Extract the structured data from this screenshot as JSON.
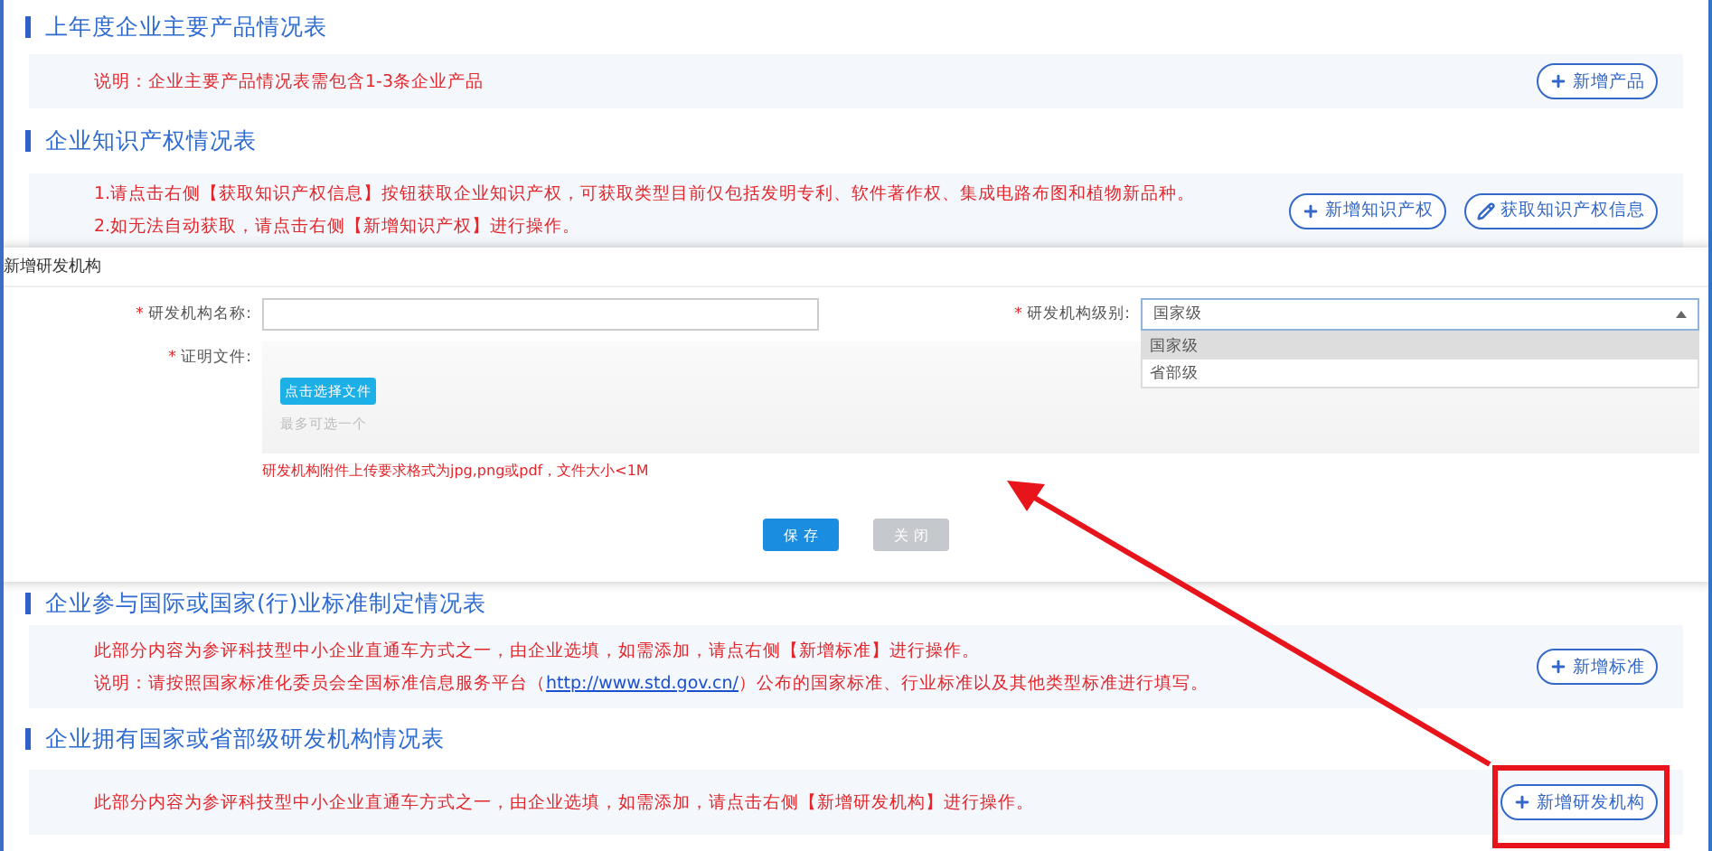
{
  "upper_sections": [
    {
      "title": "上年度企业主要产品情况表",
      "notes": [
        {
          "parts": [
            {
              "kind": "text",
              "text": "说明：企业主要产品情况表需包含1-3条企业产品"
            }
          ]
        }
      ],
      "buttons": [
        {
          "label": "新增产品",
          "kind": "add"
        }
      ]
    },
    {
      "title": "企业知识产权情况表",
      "notes": [
        {
          "parts": [
            {
              "kind": "text",
              "text": "1.请点击右侧【获取知识产权信息】按钮获取企业知识产权，可获取类型目前仅包括发明专利、软件著作权、集成电路布图和植物新品种。"
            }
          ]
        },
        {
          "parts": [
            {
              "kind": "text",
              "text": "2.如无法自动获取，请点击右侧【新增知识产权】进行操作。"
            }
          ]
        }
      ],
      "buttons": [
        {
          "label": "新增知识产权",
          "kind": "add"
        },
        {
          "label": "获取知识产权信息",
          "kind": "fetch"
        }
      ]
    }
  ],
  "dialog": {
    "title": "新增研发机构",
    "name_field": {
      "label": "研发机构名称:",
      "marker": "*"
    },
    "level_field": {
      "label": "研发机构级别:",
      "marker": "*",
      "value": "国家级",
      "expanded": true,
      "options": [
        {
          "label": "国家级",
          "selected": true
        },
        {
          "label": "省部级",
          "selected": false
        }
      ]
    },
    "file_field": {
      "label": "证明文件:",
      "marker": "*",
      "button": "点击选择文件",
      "hint": "最多可选一个",
      "note": "研发机构附件上传要求格式为jpg,png或pdf，文件大小<1M"
    },
    "buttons": [
      {
        "label": "保 存",
        "kind": "primary"
      },
      {
        "label": "关 闭",
        "kind": "secondary"
      }
    ]
  },
  "lower_sections": [
    {
      "title": "企业参与国际或国家(行)业标准制定情况表",
      "notes": [
        {
          "parts": [
            {
              "kind": "text",
              "text": "此部分内容为参评科技型中小企业直通车方式之一，由企业选填，如需添加，请点右侧【新增标准】进行操作。"
            }
          ]
        },
        {
          "parts": [
            {
              "kind": "text",
              "text": "说明：请按照国家标准化委员会全国标准信息服务平台（"
            },
            {
              "kind": "link",
              "text": "http://www.std.gov.cn/"
            },
            {
              "kind": "text",
              "text": "）公布的国家标准、行业标准以及其他类型标准进行填写。"
            }
          ]
        }
      ],
      "buttons": [
        {
          "label": "新增标准",
          "kind": "add"
        }
      ]
    },
    {
      "title": "企业拥有国家或省部级研发机构情况表",
      "notes": [
        {
          "parts": [
            {
              "kind": "text",
              "text": "此部分内容为参评科技型中小企业直通车方式之一，由企业选填，如需添加，请点击右侧【新增研发机构】进行操作。"
            }
          ]
        }
      ],
      "buttons": [
        {
          "label": "新增研发机构",
          "kind": "add"
        }
      ]
    }
  ]
}
